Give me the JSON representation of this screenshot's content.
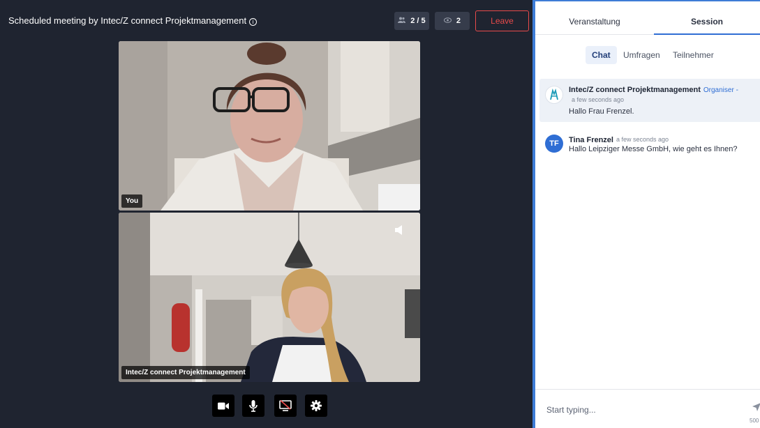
{
  "meeting": {
    "title": "Scheduled meeting by Intec/Z connect Projektmanagement",
    "title_info_glyph": "i",
    "participants": "2 / 5",
    "participants_icon": "people-icon",
    "viewers": "2",
    "viewers_icon": "eye-icon",
    "leave_label": "Leave",
    "tiles": [
      {
        "label": "You"
      },
      {
        "label": "Intec/Z connect Projektmanagement",
        "speaker_icon": "speaker-icon"
      }
    ],
    "controls": [
      "camera-icon",
      "microphone-icon",
      "screen-share-off-icon",
      "settings-icon"
    ]
  },
  "side": {
    "tabs": [
      "Veranstaltung",
      "Session"
    ],
    "active_tab": "Session",
    "subtabs": [
      "Chat",
      "Umfragen",
      "Teilnehmer"
    ],
    "active_subtab": "Chat",
    "messages": [
      {
        "author": "Intec/Z connect Projektmanagement",
        "role": "Organiser -",
        "time": "a few seconds ago",
        "text": "Hallo Frau Frenzel.",
        "avatar": "organiser-logo-icon"
      },
      {
        "author": "Tina Frenzel",
        "initials": "TF",
        "time": "a few seconds ago",
        "text": "Hallo Leipziger Messe GmbH, wie geht es Ihnen?"
      }
    ],
    "composer": {
      "placeholder": "Start typing...",
      "counter": "500"
    }
  },
  "colors": {
    "meeting_bg": "#1f2430",
    "accent": "#2f6ed4",
    "leave": "#e84a4a"
  }
}
